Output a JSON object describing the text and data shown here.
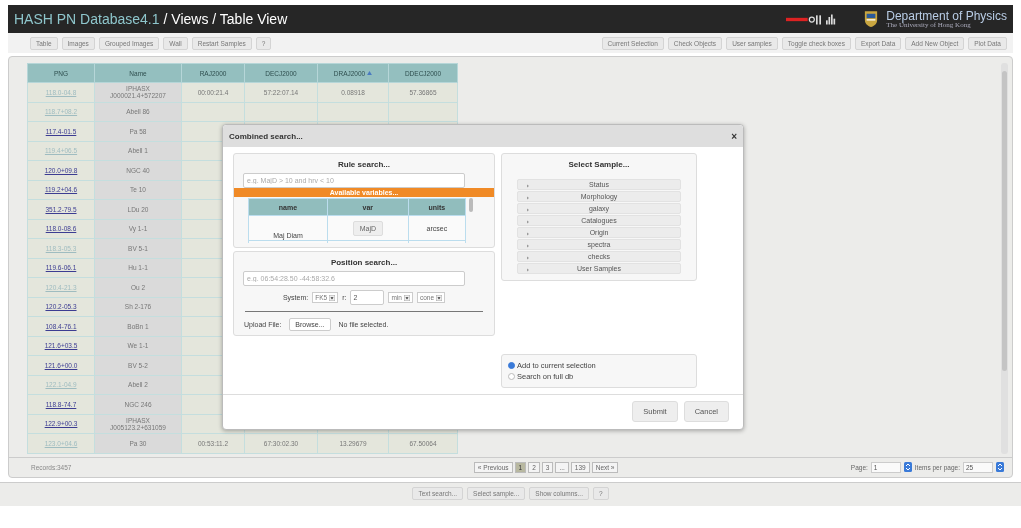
{
  "header": {
    "app_name": "HASH PN Database4.1",
    "breadcrumb": "/ Views / Table View",
    "dept": "Department of Physics",
    "university": "The University of Hong Kong"
  },
  "toolbar_left": [
    "Table",
    "Images",
    "Grouped Images",
    "Wall",
    "Restart Samples",
    "?"
  ],
  "toolbar_right": [
    "Current Selection",
    "Check Objects",
    "User samples",
    "Toggle check boxes",
    "Export Data",
    "Add New Object",
    "Plot Data"
  ],
  "table": {
    "columns": [
      {
        "label": "PNG",
        "sorted": false
      },
      {
        "label": "Name",
        "sorted": false
      },
      {
        "label": "RAJ2000",
        "sorted": false
      },
      {
        "label": "DECJ2000",
        "sorted": false
      },
      {
        "label": "DRAJ2000",
        "sorted": true
      },
      {
        "label": "DDECJ2000",
        "sorted": false
      }
    ],
    "rows": [
      {
        "png": "118.0-04.8",
        "visited": true,
        "name": "IPHASX J000021.4+572207",
        "cells": [
          "00:00:21.4",
          "57:22:07.14",
          "0.08918",
          "57.36865"
        ]
      },
      {
        "png": "118.7+08.2",
        "visited": true,
        "name": "Abell 86"
      },
      {
        "png": "117.4-01.5",
        "visited": false,
        "name": "Pa 58"
      },
      {
        "png": "119.4+06.5",
        "visited": true,
        "name": "Abell 1"
      },
      {
        "png": "120.0+09.8",
        "visited": false,
        "name": "NGC 40"
      },
      {
        "png": "119.2+04.6",
        "visited": false,
        "name": "Te 10"
      },
      {
        "png": "351.2-79.5",
        "visited": false,
        "name": "LDu 20"
      },
      {
        "png": "118.0-08.6",
        "visited": false,
        "name": "Vy 1-1"
      },
      {
        "png": "118.3-05.3",
        "visited": true,
        "name": "BV 5-1"
      },
      {
        "png": "119.6-06.1",
        "visited": false,
        "name": "Hu 1-1"
      },
      {
        "png": "120.4-21.3",
        "visited": true,
        "name": "Ou 2"
      },
      {
        "png": "120.2-05.3",
        "visited": false,
        "name": "Sh 2-176"
      },
      {
        "png": "108.4-76.1",
        "visited": false,
        "name": "BoBn 1"
      },
      {
        "png": "121.6+03.5",
        "visited": false,
        "name": "We 1-1"
      },
      {
        "png": "121.6+00.0",
        "visited": false,
        "name": "BV 5-2"
      },
      {
        "png": "122.1-04.9",
        "visited": true,
        "name": "Abell 2"
      },
      {
        "png": "118.8-74.7",
        "visited": false,
        "name": "NGC 246"
      },
      {
        "png": "122.9+00.3",
        "visited": false,
        "name": "IPHASX J005123.2+631059"
      },
      {
        "png": "123.0+04.6",
        "visited": true,
        "name": "Pa 30",
        "cells": [
          "00:53:11.2",
          "67:30:02.30",
          "13.29679",
          "67.50064"
        ]
      }
    ]
  },
  "records": "Records:3457",
  "pagination": {
    "pages": [
      {
        "label": "« Previous",
        "selected": false
      },
      {
        "label": "1",
        "selected": true
      },
      {
        "label": "2",
        "selected": false
      },
      {
        "label": "3",
        "selected": false
      },
      {
        "label": "...",
        "selected": false
      },
      {
        "label": "139",
        "selected": false
      },
      {
        "label": "Next »",
        "selected": false
      }
    ],
    "page_label": "Page:",
    "page": "1",
    "items_label": "Items per page:",
    "items": "25"
  },
  "bottom_buttons": [
    "Text search...",
    "Select sample...",
    "Show columns...",
    "?"
  ],
  "dialog": {
    "title": "Combined search...",
    "close": "×",
    "rule_search": {
      "title": "Rule search...",
      "placeholder": "e.g. MajD > 10 and hrv < 10",
      "variables_label": "Available variables...",
      "columns": [
        "name",
        "var",
        "units"
      ],
      "rows": [
        {
          "name": "Maj Diam",
          "var": "MajD",
          "units": "arcsec"
        }
      ]
    },
    "position_search": {
      "title": "Position search...",
      "placeholder": "e.g. 06:54:28.50 -44:58:32.6",
      "system_label": "System:",
      "system": "FK5",
      "r_label": "r:",
      "r": "2",
      "unit": "min",
      "shape": "cone",
      "upload_label": "Upload File:",
      "browse": "Browse...",
      "file_status": "No file selected."
    },
    "select_sample": {
      "title": "Select Sample...",
      "items": [
        "Status",
        "Morphology",
        "galaxy",
        "Catalogues",
        "Origin",
        "spectra",
        "checks",
        "User Samples"
      ]
    },
    "scope": [
      {
        "label": "Add to current selection",
        "selected": true
      },
      {
        "label": "Search on full db",
        "selected": false
      }
    ],
    "buttons": [
      "Submit",
      "Cancel"
    ]
  }
}
